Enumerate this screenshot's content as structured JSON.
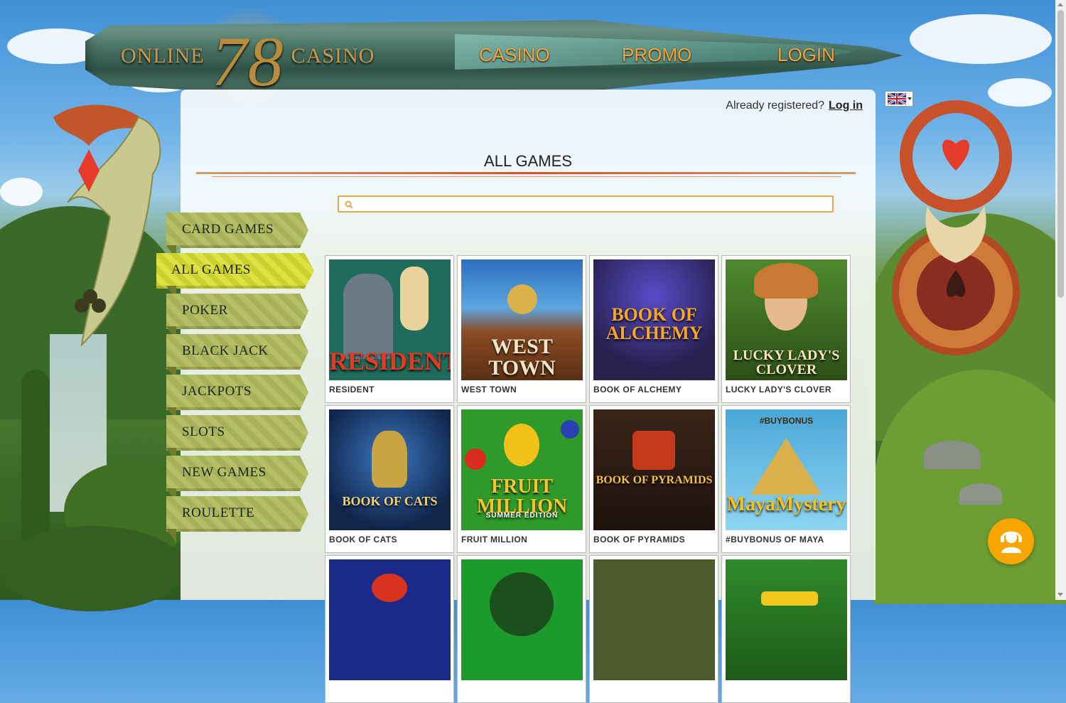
{
  "header": {
    "logo_left": "ONLINE",
    "logo_number": "78",
    "logo_right": "CASINO",
    "nav": [
      "CASINO",
      "PROMO",
      "LOGIN"
    ]
  },
  "account": {
    "prompt": "Already registered?",
    "login_link": "Log in"
  },
  "language": {
    "flag": "uk-flag-icon"
  },
  "page": {
    "title": "ALL GAMES"
  },
  "search": {
    "placeholder": "",
    "value": ""
  },
  "categories": [
    {
      "label": "CARD GAMES"
    },
    {
      "label": "ALL GAMES",
      "active": true
    },
    {
      "label": "POKER"
    },
    {
      "label": "BLACK JACK"
    },
    {
      "label": "JACKPOTS"
    },
    {
      "label": "SLOTS"
    },
    {
      "label": "NEW GAMES"
    },
    {
      "label": "ROULETTE"
    }
  ],
  "games": [
    {
      "name": "RESIDENT",
      "art": "RESIDENT",
      "bg": "#1f6b5d"
    },
    {
      "name": "WEST TOWN",
      "art": "WEST TOWN",
      "bg": "#8a4b24"
    },
    {
      "name": "BOOK OF ALCHEMY",
      "art": "BOOK OF ALCHEMY",
      "bg": "#27214f"
    },
    {
      "name": "LUCKY LADY'S CLOVER",
      "art": "LUCKY LADY'S CLOVER",
      "bg": "#3f6a22"
    },
    {
      "name": "BOOK OF CATS",
      "art": "BOOK OF CATS",
      "bg": "#1e3f6b"
    },
    {
      "name": "FRUIT MILLION",
      "art": "FRUIT MILLION",
      "art_sub": "SUMMER EDITION",
      "bg": "#2f9a2a"
    },
    {
      "name": "BOOK OF PYRAMIDS",
      "art": "BOOK OF PYRAMIDS",
      "bg": "#3a2418"
    },
    {
      "name": "#BUYBONUS OF MAYA",
      "art": "MayaMystery",
      "art_top": "#BUYBONUS",
      "bg": "#4aa7d8"
    },
    {
      "name": "",
      "art": "",
      "bg": "#1b2a8a"
    },
    {
      "name": "",
      "art": "",
      "bg": "#1c9a2c"
    },
    {
      "name": "",
      "art": "",
      "bg": "#4d5a2a"
    },
    {
      "name": "",
      "art": "",
      "bg": "#2f8a2a"
    }
  ],
  "colors": {
    "nav_text": "#f7a43a",
    "accent_orange": "#f7a600",
    "category_green": "#b5c066",
    "category_active": "#dde145"
  },
  "icons": {
    "search": "search-icon",
    "chat": "support-agent-icon"
  }
}
